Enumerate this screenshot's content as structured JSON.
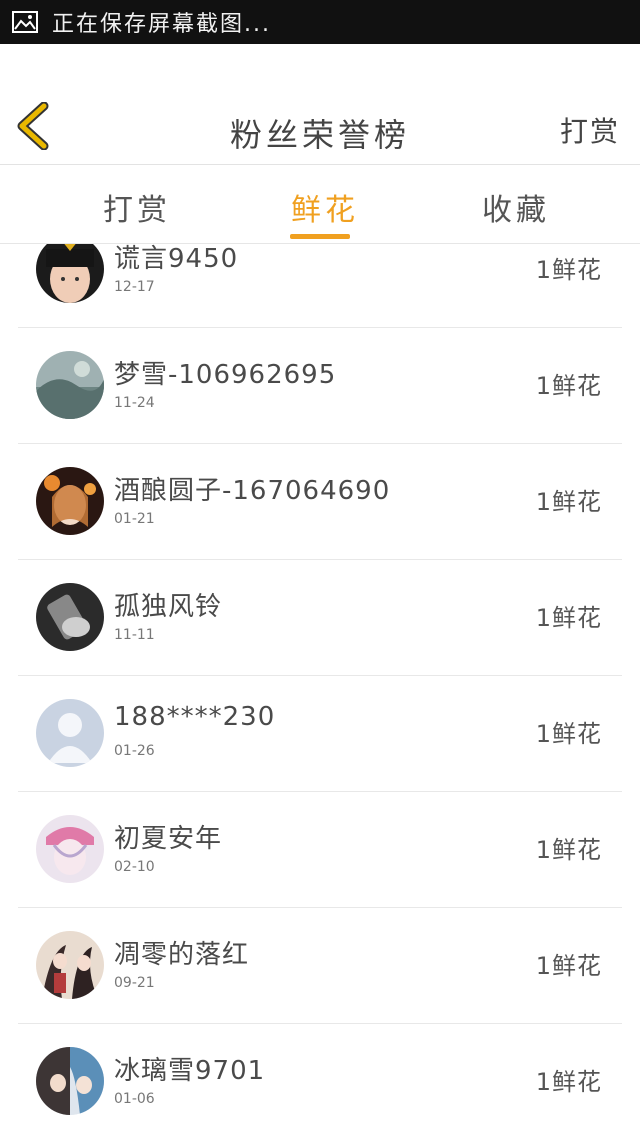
{
  "status": {
    "text": "正在保存屏幕截图..."
  },
  "nav": {
    "title": "粉丝荣誉榜",
    "right_label": "打赏"
  },
  "tabs": [
    {
      "label": "打赏",
      "active": false
    },
    {
      "label": "鲜花",
      "active": true
    },
    {
      "label": "收藏",
      "active": false
    }
  ],
  "colors": {
    "accent": "#f0a020",
    "back_icon": "#e9b800"
  },
  "list": [
    {
      "name": "谎言9450",
      "date": "12-17",
      "gift": "1鲜花"
    },
    {
      "name": "梦雪-106962695",
      "date": "11-24",
      "gift": "1鲜花"
    },
    {
      "name": "酒酿圆子-167064690",
      "date": "01-21",
      "gift": "1鲜花"
    },
    {
      "name": "孤独风铃",
      "date": "11-11",
      "gift": "1鲜花"
    },
    {
      "name": "188****230",
      "date": "01-26",
      "gift": "1鲜花"
    },
    {
      "name": "初夏安年",
      "date": "02-10",
      "gift": "1鲜花"
    },
    {
      "name": "凋零的落红",
      "date": "09-21",
      "gift": "1鲜花"
    },
    {
      "name": "冰璃雪9701",
      "date": "01-06",
      "gift": "1鲜花"
    }
  ]
}
